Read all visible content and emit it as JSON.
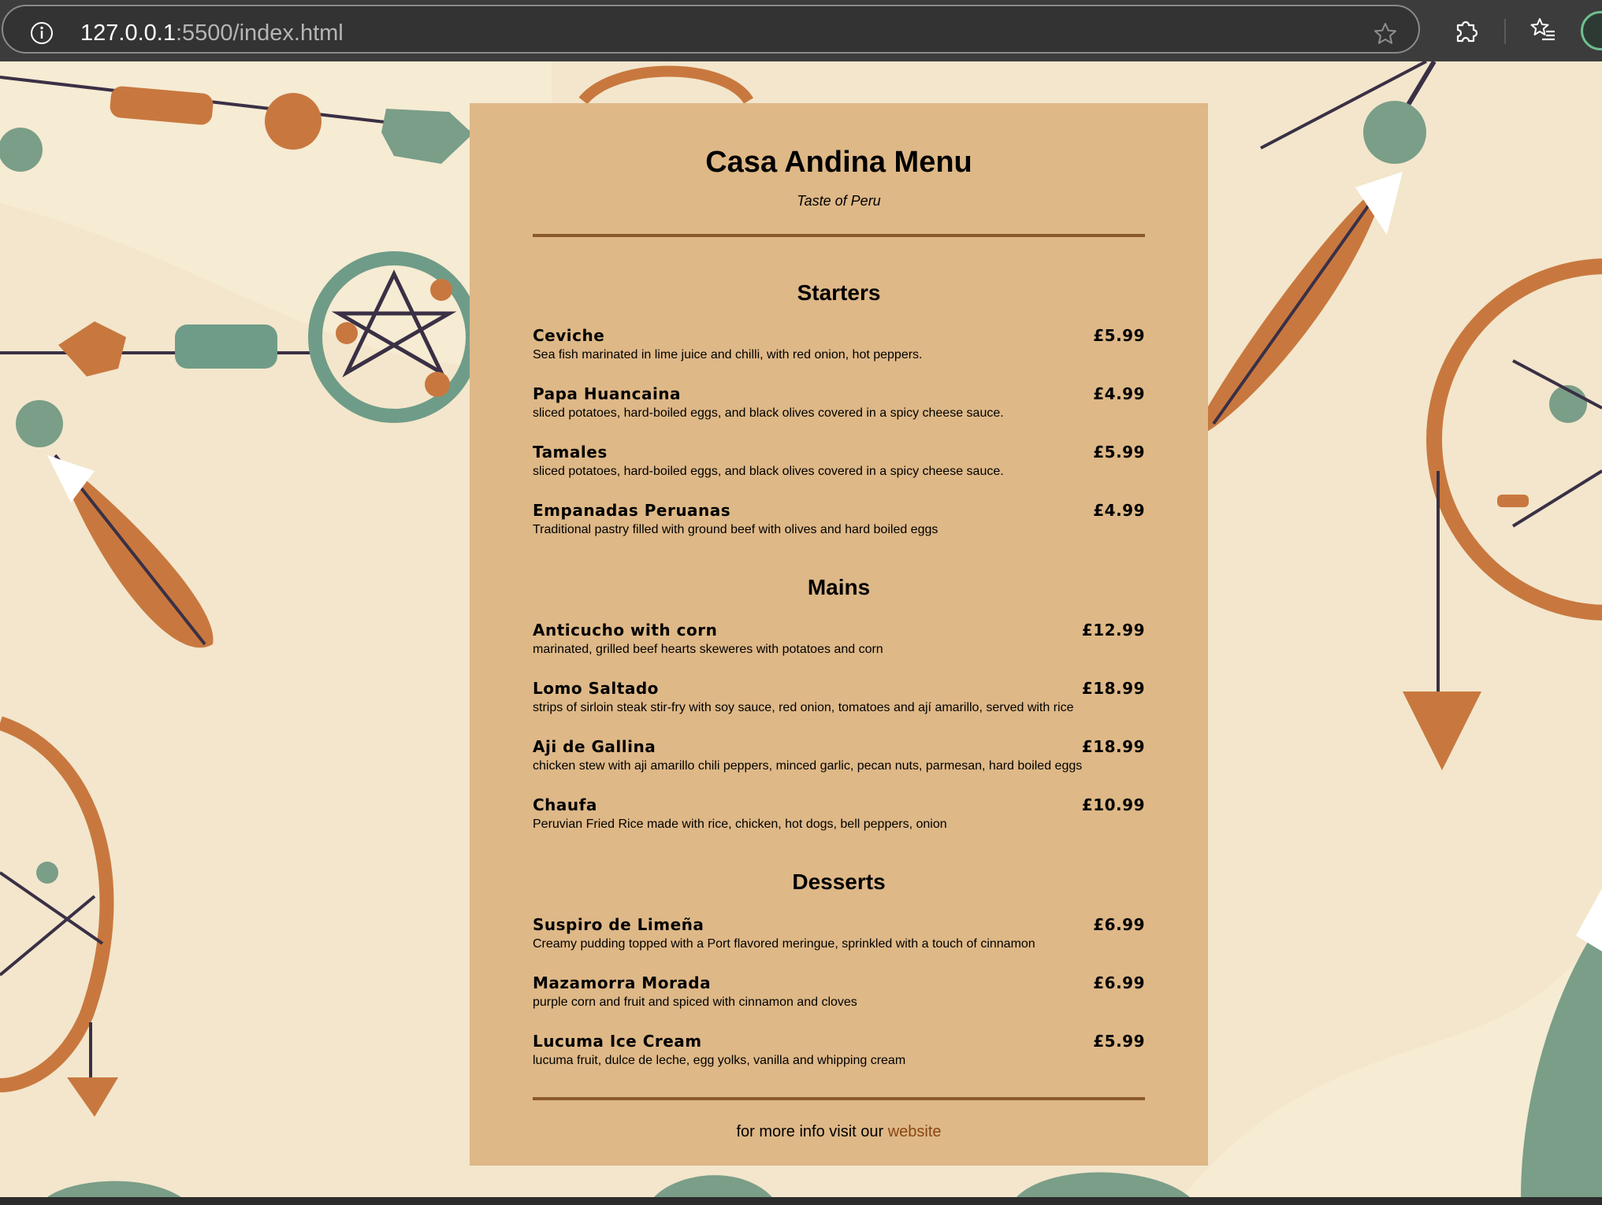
{
  "browser": {
    "url_host": "127.0.0.1",
    "url_path": ":5500/index.html",
    "icons": [
      "info-icon",
      "star-icon",
      "extensions-icon",
      "favorites-icon",
      "profile-icon"
    ]
  },
  "colors": {
    "menu_background": "#deb887",
    "divider": "#8b5a2b",
    "link": "#8b4513",
    "page_background": "#f3e6cc"
  },
  "menu": {
    "title": "Casa Andina Menu",
    "tagline": "Taste of Peru",
    "sections": [
      {
        "title": "Starters",
        "items": [
          {
            "name": "Ceviche",
            "price": "£5.99",
            "description": "Sea fish marinated in lime juice and chilli, with red onion, hot peppers."
          },
          {
            "name": "Papa Huancaina",
            "price": "£4.99",
            "description": "sliced potatoes, hard-boiled eggs, and black olives covered in a spicy cheese sauce."
          },
          {
            "name": "Tamales",
            "price": "£5.99",
            "description": "sliced potatoes, hard-boiled eggs, and black olives covered in a spicy cheese sauce."
          },
          {
            "name": "Empanadas Peruanas",
            "price": "£4.99",
            "description": "Traditional pastry filled with ground beef with olives and hard boiled eggs"
          }
        ]
      },
      {
        "title": "Mains",
        "items": [
          {
            "name": "Anticucho with corn",
            "price": "£12.99",
            "description": "marinated, grilled beef hearts skeweres with potatoes and corn"
          },
          {
            "name": "Lomo Saltado",
            "price": "£18.99",
            "description": "strips of sirloin steak stir-fry with soy sauce, red onion, tomatoes and ají amarillo, served with rice"
          },
          {
            "name": "Aji de Gallina",
            "price": "£18.99",
            "description": "chicken stew with aji amarillo chili peppers, minced garlic, pecan nuts, parmesan, hard boiled eggs"
          },
          {
            "name": "Chaufa",
            "price": "£10.99",
            "description": "Peruvian Fried Rice made with rice, chicken, hot dogs, bell peppers, onion"
          }
        ]
      },
      {
        "title": "Desserts",
        "items": [
          {
            "name": "Suspiro de Limeña",
            "price": "£6.99",
            "description": "Creamy pudding topped with a Port flavored meringue, sprinkled with a touch of cinnamon"
          },
          {
            "name": "Mazamorra Morada",
            "price": "£6.99",
            "description": "purple corn and fruit and spiced with cinnamon and cloves"
          },
          {
            "name": "Lucuma Ice Cream",
            "price": "£5.99",
            "description": "lucuma fruit, dulce de leche, egg yolks, vanilla and whipping cream"
          }
        ]
      }
    ],
    "footer": {
      "text": "for more info visit our ",
      "link_text": "website"
    }
  }
}
